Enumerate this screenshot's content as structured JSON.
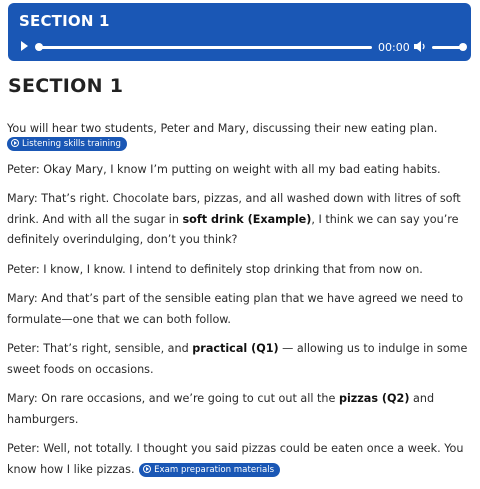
{
  "player": {
    "title": "SECTION 1",
    "time": "00:00",
    "progress": 0,
    "volume": 1.0
  },
  "heading": "SECTION 1",
  "intro": "You will hear two students, Peter and Mary, discussing their new eating plan.",
  "badges": {
    "listening": "Listening skills training",
    "exam": "Exam preparation materials"
  },
  "dialogue": {
    "p1": "Peter: Okay Mary, I know I’m putting on weight with all my bad eating habits.",
    "p2_a": "Mary: That’s right. Chocolate bars, pizzas, and all washed down with litres of soft drink. And with all the sugar in ",
    "p2_b": "soft drink (Example)",
    "p2_c": ", I think we can say you’re definitely overindulging, don’t you think?",
    "p3": "Peter: I know, I know. I intend to definitely stop drinking that from now on.",
    "p4": "Mary: And that’s part of the sensible eating plan that we have agreed we need to formulate—one that we can both follow.",
    "p5_a": "Peter: That’s right, sensible, and ",
    "p5_b": "practical (Q1)",
    "p5_c": " — allowing us to indulge in some sweet foods on occasions.",
    "p6_a": "Mary: On rare occasions, and we’re going to cut out all the ",
    "p6_b": "pizzas (Q2)",
    "p6_c": " and hamburgers.",
    "p7": "Peter: Well, not totally. I thought you said pizzas could be eaten once a week. You know how I like pizzas."
  }
}
